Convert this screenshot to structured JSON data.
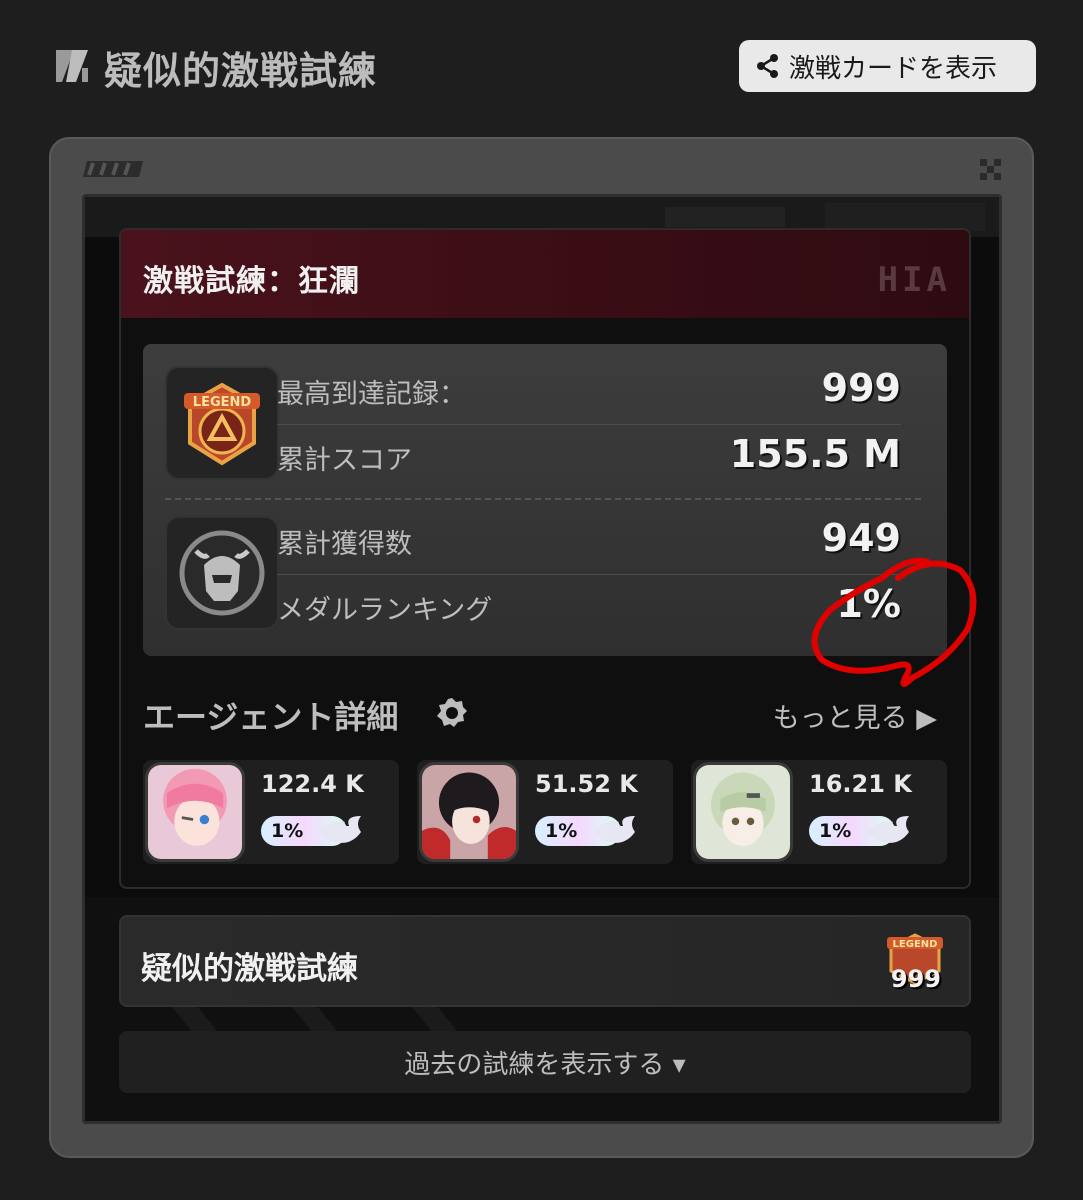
{
  "header": {
    "title": "疑似的激戦試練",
    "share_button_label": "激戦カードを表示"
  },
  "challenge": {
    "title": "激戦試練：狂瀾",
    "watermark": "HIA",
    "stats": [
      {
        "label": "最高到達記録：",
        "value": "999"
      },
      {
        "label": "累計スコア",
        "value": "155.5 M"
      },
      {
        "label": "累計獲得数",
        "value": "949"
      },
      {
        "label": "メダルランキング",
        "value": "1%"
      }
    ],
    "badges": {
      "top": "legend-badge-icon",
      "bottom": "helmet-medal-icon"
    }
  },
  "agents": {
    "title": "エージェント詳細",
    "more_label": "もっと見る ▶",
    "items": [
      {
        "score": "122.4 K",
        "rank": "1%",
        "hair_color": "#f29ab4"
      },
      {
        "score": "51.52 K",
        "rank": "1%",
        "hair_color": "#1e1a1e"
      },
      {
        "score": "16.21 K",
        "rank": "1%",
        "hair_color": "#c9d8b8"
      }
    ]
  },
  "simulated": {
    "title": "疑似的激戦試練",
    "badge_label": "LEGEND",
    "badge_count": "999"
  },
  "past_button_label": "過去の試練を表示する ▾",
  "colors": {
    "background": "#1e1e1e",
    "panel_head": "#4a121c",
    "annotation": "#e00000"
  }
}
